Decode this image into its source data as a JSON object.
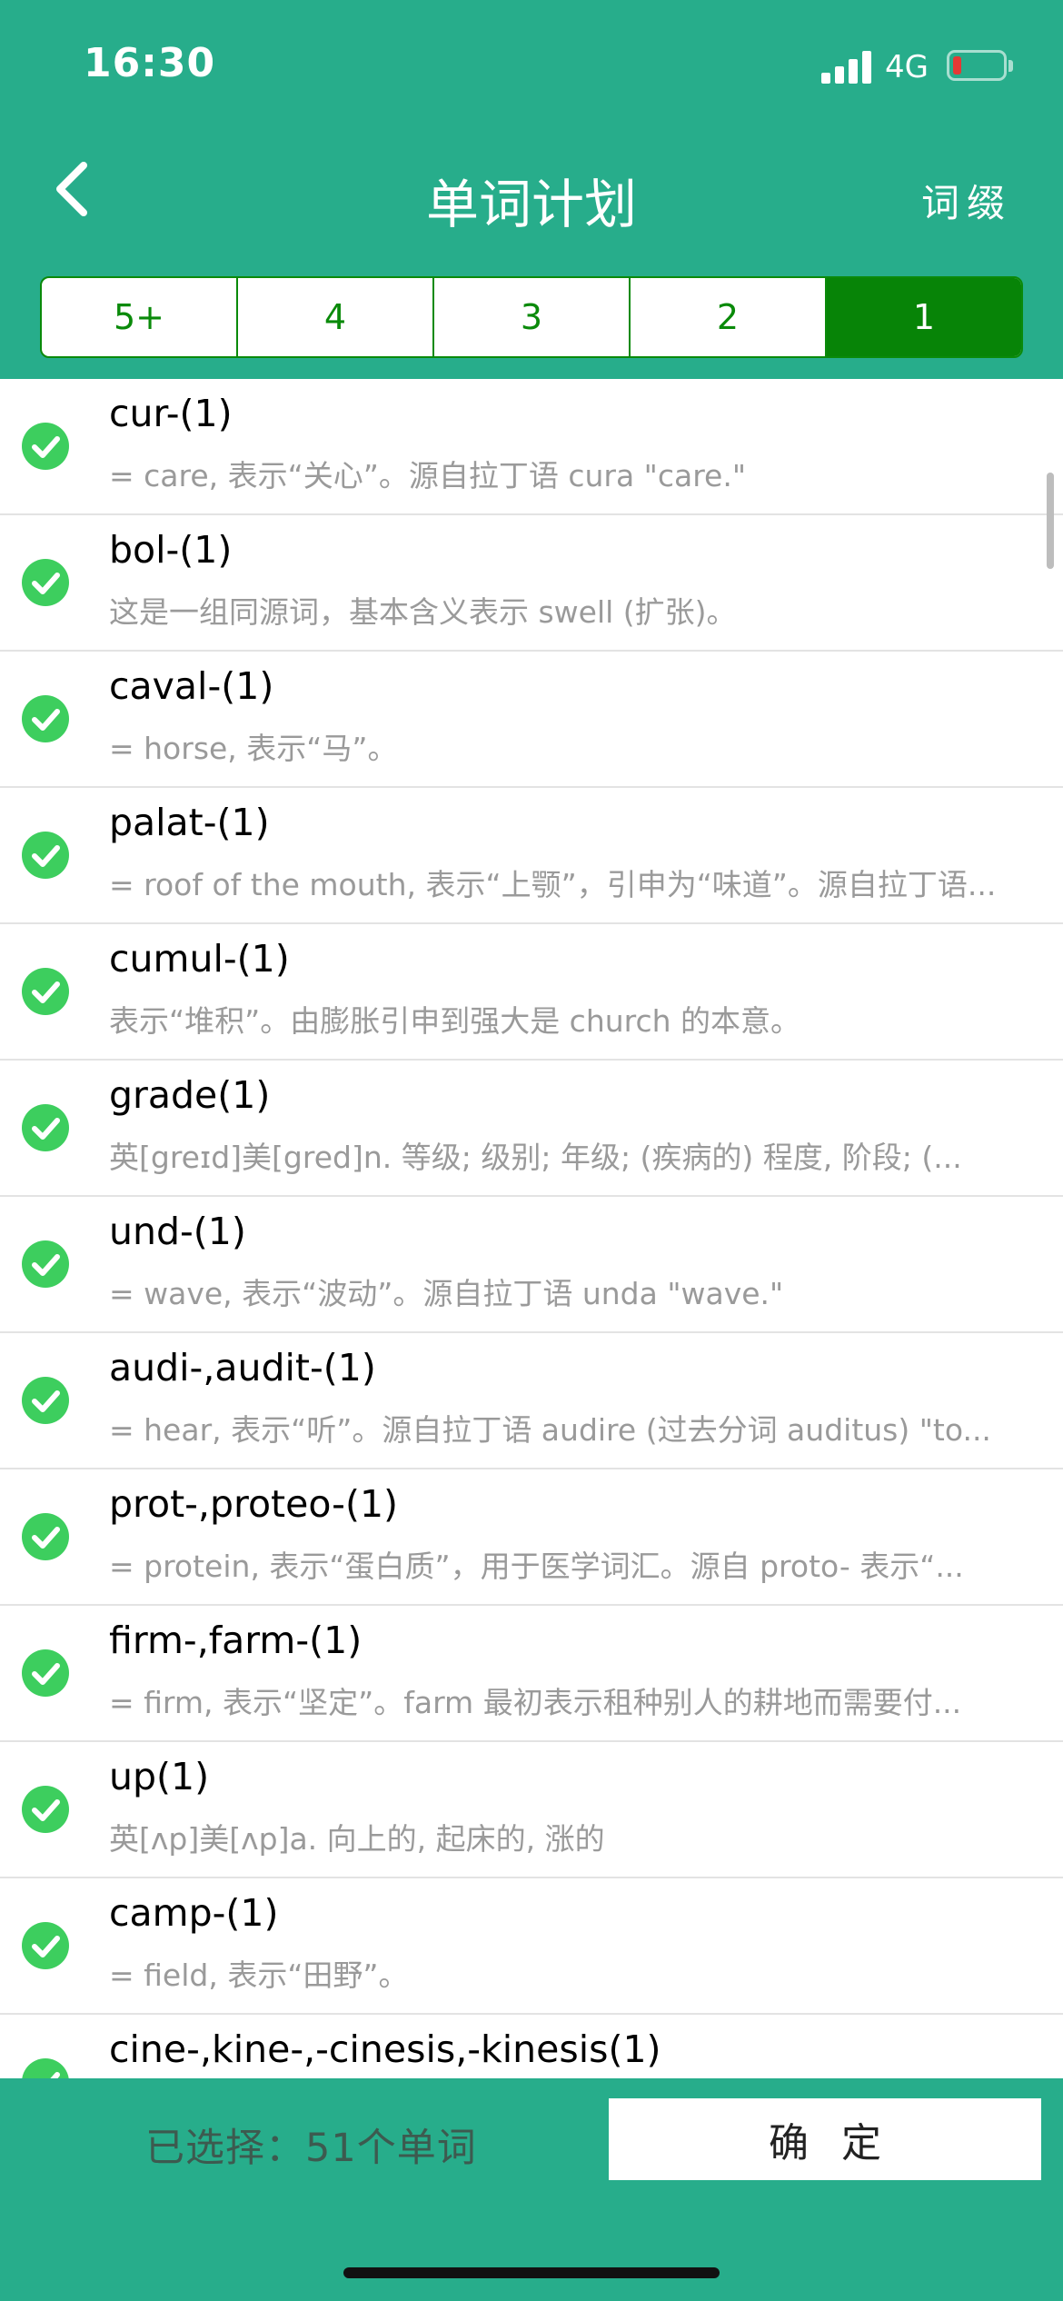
{
  "status_bar": {
    "time": "16:30",
    "network": "4G",
    "battery_level": 0.1
  },
  "nav": {
    "title": "单词计划",
    "action": "词缀",
    "back_icon": "chevron-left-icon"
  },
  "segments": {
    "items": [
      "5+",
      "4",
      "3",
      "2",
      "1"
    ],
    "active": "1",
    "accent_color": "#078407"
  },
  "list": {
    "items": [
      {
        "title": "cur-(1)",
        "desc": "= care, 表示“关心”。源自拉丁语 cura \"care.\"",
        "checked": true
      },
      {
        "title": "bol-(1)",
        "desc": "这是一组同源词，基本含义表示 swell (扩张)。",
        "checked": true
      },
      {
        "title": "caval-(1)",
        "desc": "= horse, 表示“马”。",
        "checked": true
      },
      {
        "title": "palat-(1)",
        "desc": "= roof of the mouth, 表示“上颚”，引申为“味道”。源自拉丁语...",
        "checked": true
      },
      {
        "title": "cumul-(1)",
        "desc": "表示“堆积”。由膨胀引申到强大是 church 的本意。",
        "checked": true
      },
      {
        "title": "grade(1)",
        "desc": "英[greɪd]美[gred]n. 等级; 级别; 年级; (疾病的) 程度, 阶段; (...",
        "checked": true
      },
      {
        "title": "und-(1)",
        "desc": "= wave, 表示“波动”。源自拉丁语 unda \"wave.\"",
        "checked": true
      },
      {
        "title": "audi-,audit-(1)",
        "desc": "= hear, 表示“听”。源自拉丁语 audire (过去分词 auditus) \"to...",
        "checked": true
      },
      {
        "title": "prot-,proteo-(1)",
        "desc": "= protein, 表示“蛋白质”，用于医学词汇。源自 proto- 表示“...",
        "checked": true
      },
      {
        "title": "firm-,farm-(1)",
        "desc": "= firm, 表示“坚定”。farm 最初表示租种别人的耕地而需要付...",
        "checked": true
      },
      {
        "title": "up(1)",
        "desc": "英[ʌp]美[ʌp]a. 向上的, 起床的, 涨的",
        "checked": true
      },
      {
        "title": "camp-(1)",
        "desc": "= field, 表示“田野”。",
        "checked": true
      },
      {
        "title": "cine-,kine-,-cinesis,-kinesis(1)",
        "desc": "",
        "checked": true
      }
    ],
    "check_color": "#3dce5e"
  },
  "footer": {
    "selected_label": "已选择：51个单词",
    "confirm_label": "确定"
  },
  "colors": {
    "primary": "#27ad8b",
    "segment_green": "#078407"
  }
}
